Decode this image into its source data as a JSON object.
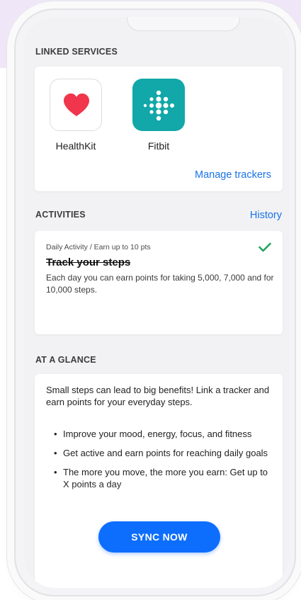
{
  "linked_services": {
    "title": "LINKED SERVICES",
    "services": [
      {
        "name": "HealthKit",
        "icon": "heart-icon",
        "icon_color": "#f0354c"
      },
      {
        "name": "Fitbit",
        "icon": "fitbit-dots-icon",
        "icon_color": "#12a7a8"
      }
    ],
    "manage_link": "Manage trackers"
  },
  "activities": {
    "title": "ACTIVITIES",
    "history_link": "History",
    "items": [
      {
        "subtitle": "Daily Activity / Earn up to 10 pts",
        "title": "Track your steps",
        "description": "Each day you can earn points for taking 5,000, 7,000 and for 10,000 steps.",
        "status_icon": "check-icon",
        "status_color": "#22a45d"
      }
    ]
  },
  "at_a_glance": {
    "title": "AT A GLANCE",
    "intro": "Small steps can lead to big benefits! Link a tracker and earn points for your everyday steps.",
    "bullets": [
      "Improve your mood, energy, focus, and fitness",
      "Get active and earn points for reaching daily goals",
      "The more you move, the more you earn: Get up to X points a day"
    ]
  },
  "sync_button": "SYNC NOW",
  "colors": {
    "accent": "#0d6efd",
    "link": "#1a73e8",
    "background": "#f2f2f4",
    "frame_background": "#efe7f8"
  }
}
